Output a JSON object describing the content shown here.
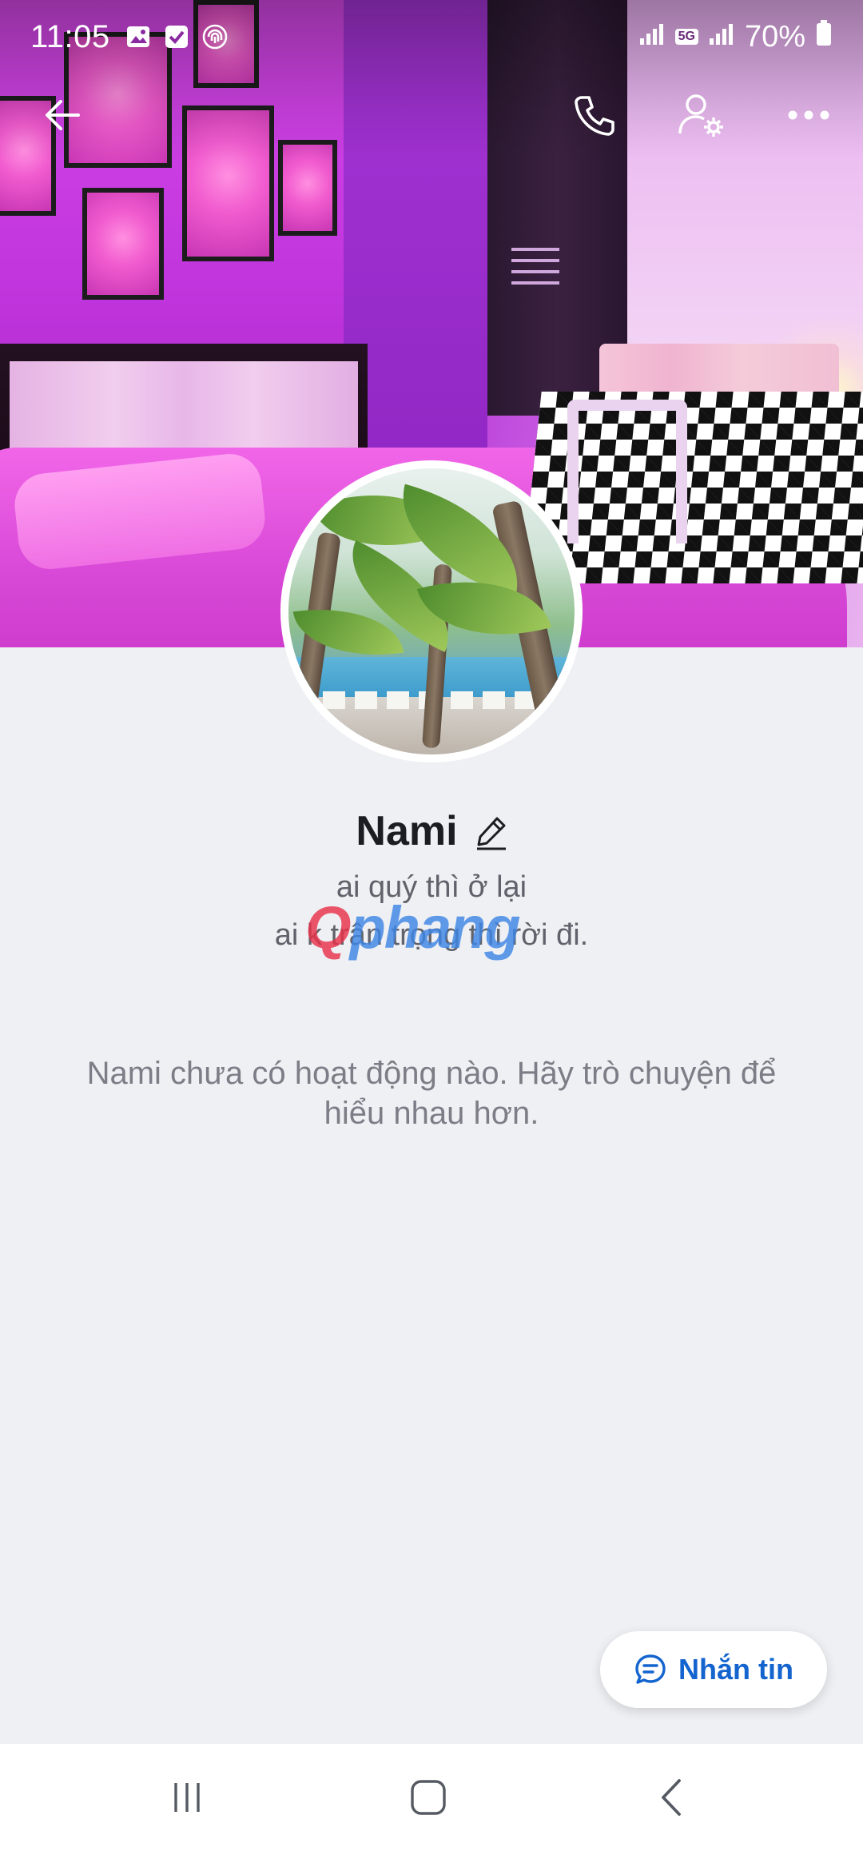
{
  "status_bar": {
    "time": "11:05",
    "network": "5G",
    "battery": "70%",
    "icons": [
      "gallery-icon",
      "check-icon",
      "fingerprint-icon",
      "signal-icon",
      "battery-icon"
    ]
  },
  "app_bar": {
    "icons": [
      "back-arrow-icon",
      "phone-icon",
      "user-settings-icon",
      "more-icon"
    ]
  },
  "profile": {
    "name": "Nami",
    "bio_line1": "ai quý thì ở lại",
    "bio_line2": "ai k trân trọng thì rời đi.",
    "empty_message": "Nami chưa có hoạt động nào. Hãy trò chuyện để hiểu nhau hơn."
  },
  "watermark": {
    "part1": "Q",
    "part2": "phang"
  },
  "message_button": {
    "label": "Nhắn tin",
    "icon": "chat-bubble-icon"
  },
  "colors": {
    "accent": "#1464cf",
    "background": "#eff0f4"
  }
}
